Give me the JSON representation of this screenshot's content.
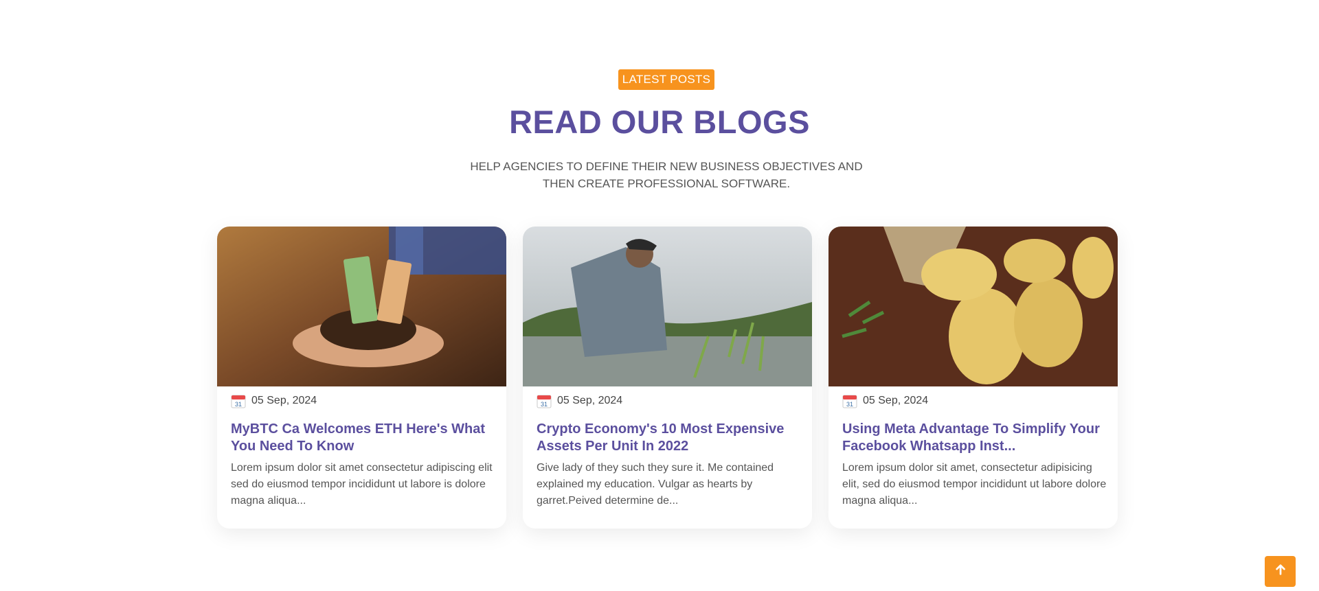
{
  "section": {
    "badge": "LATEST POSTS",
    "heading": "READ OUR BLOGS",
    "subtitle": "HELP AGENCIES TO DEFINE THEIR NEW BUSINESS OBJECTIVES AND THEN CREATE PROFESSIONAL SOFTWARE."
  },
  "posts": [
    {
      "image_icon": "money-in-soil-image",
      "date_icon": "calendar-icon",
      "date": "05 Sep, 2024",
      "title": "MyBTC Ca Welcomes ETH Here's What You Need To Know",
      "excerpt": "Lorem ipsum dolor sit amet consectetur adipiscing elit sed do eiusmod tempor incididunt ut labore is dolore magna aliqua..."
    },
    {
      "image_icon": "farmer-planting-rice-image",
      "date_icon": "calendar-icon",
      "date": "05 Sep, 2024",
      "title": "Crypto Economy's 10 Most Expensive Assets Per Unit In 2022",
      "excerpt": "Give lady of they such they sure it. Me contained explained my education. Vulgar as hearts by garret.Peived determine de..."
    },
    {
      "image_icon": "potatoes-image",
      "date_icon": "calendar-icon",
      "date": "05 Sep, 2024",
      "title": "Using Meta Advantage To Simplify Your Facebook Whatsapp Inst...",
      "excerpt": "Lorem ipsum dolor sit amet, consectetur adipisicing elit, sed do eiusmod tempor incididunt ut labore dolore magna aliqua..."
    }
  ],
  "back_to_top": {
    "icon": "arrow-up-icon"
  },
  "colors": {
    "accent": "#f7931e",
    "heading": "#5b4f9e",
    "text": "#555555"
  }
}
